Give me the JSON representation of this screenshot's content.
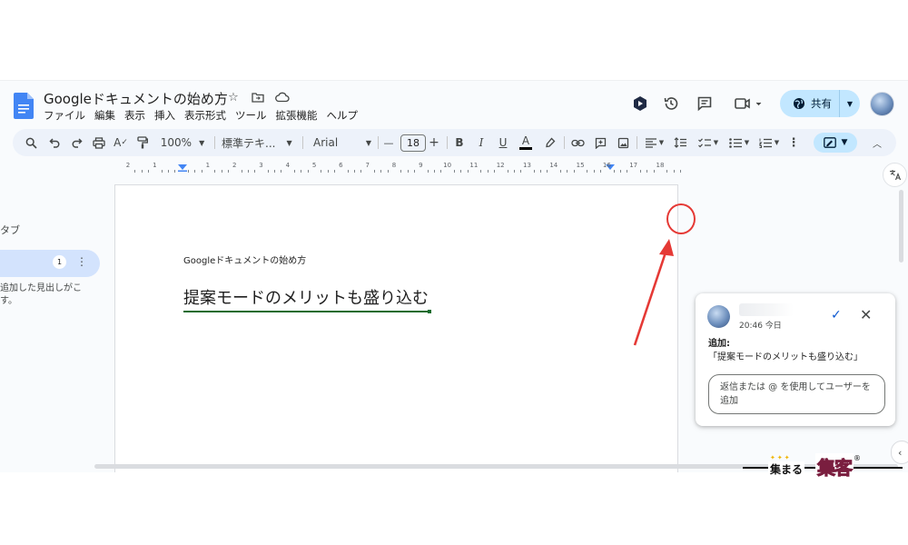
{
  "document": {
    "title": "Googleドキュメントの始め方",
    "menu": [
      "ファイル",
      "編集",
      "表示",
      "挿入",
      "表示形式",
      "ツール",
      "拡張機能",
      "ヘルプ"
    ]
  },
  "header": {
    "share_label": "共有",
    "icons": [
      "gemini-icon",
      "history-icon",
      "comment-icon",
      "meet-icon"
    ]
  },
  "toolbar": {
    "zoom": "100%",
    "style": "標準テキ...",
    "font": "Arial",
    "font_size": "18",
    "minus": "—",
    "plus": "+",
    "bold": "B",
    "italic": "I",
    "underline": "U",
    "text_color": "A"
  },
  "ruler": {
    "labels": [
      "2",
      "1",
      "",
      "1",
      "2",
      "3",
      "4",
      "5",
      "6",
      "7",
      "8",
      "9",
      "10",
      "11",
      "12",
      "13",
      "14",
      "15",
      "16",
      "17",
      "18"
    ]
  },
  "sidebar": {
    "tabs_label": "タブ",
    "tab_badge": "1",
    "outline_hint": "追加した見出しがこ す。"
  },
  "page": {
    "header_text": "Googleドキュメントの始め方",
    "suggestion_text": "提案モードのメリットも盛り込む"
  },
  "comment": {
    "time": "20:46 今日",
    "action_label": "追加:",
    "action_text": "「提案モードのメリットも盛り込む」",
    "reply_placeholder": "返信または @ を使用してユーザーを追加"
  },
  "watermark": {
    "small": "集まる",
    "big": "集客",
    "reg": "®"
  },
  "colors": {
    "accent": "#0b57d0",
    "share_bg": "#c2e7ff",
    "suggestion_green": "#146c2e",
    "annotation_red": "#e53935"
  }
}
